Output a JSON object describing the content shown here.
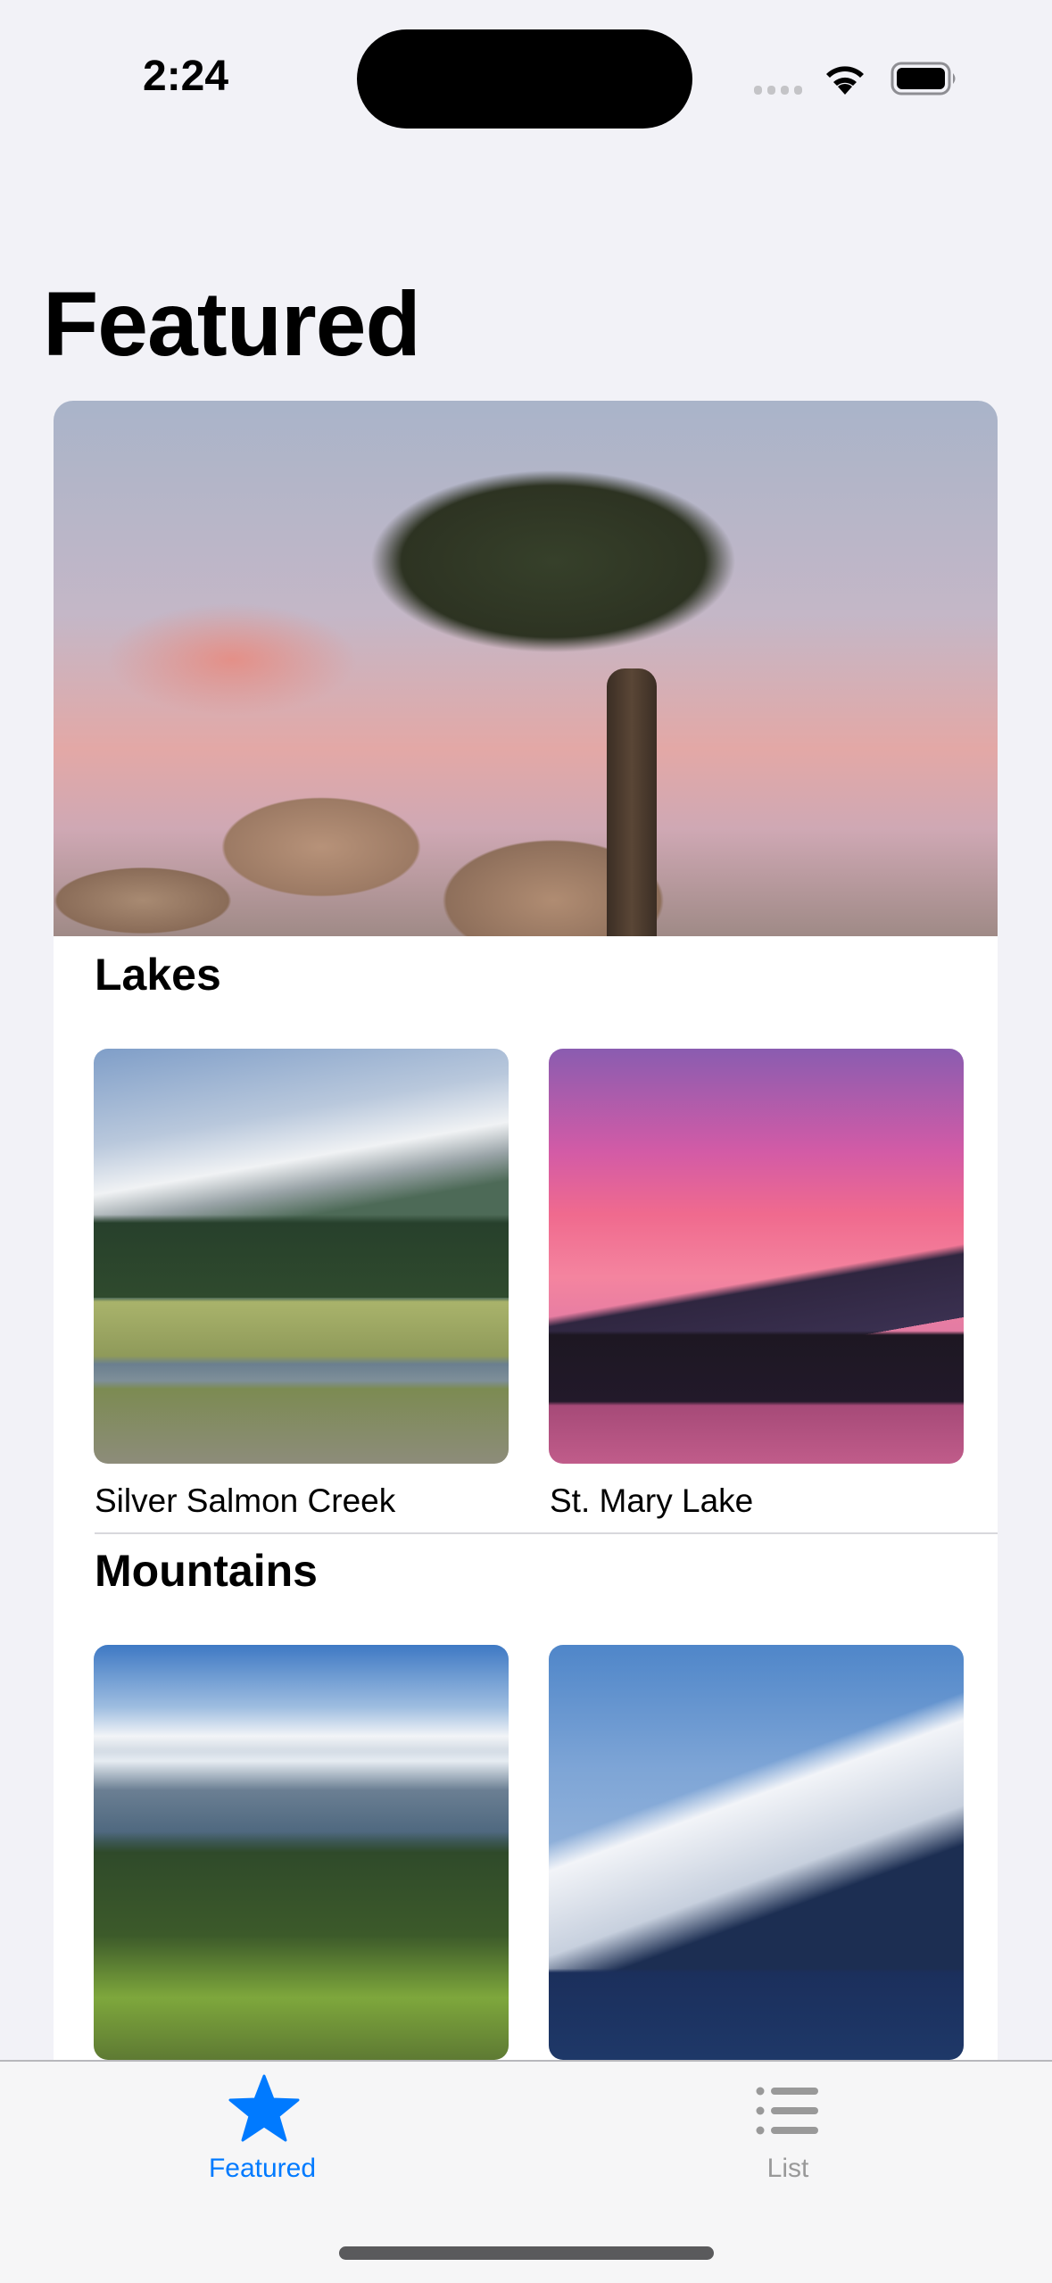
{
  "status_bar": {
    "time": "2:24",
    "icons": [
      "cellular-signal-icon",
      "wifi-icon",
      "battery-icon"
    ]
  },
  "page": {
    "title": "Featured"
  },
  "featured_image": {
    "description_icon": "joshua-tree-photo"
  },
  "sections": [
    {
      "title": "Lakes",
      "items": [
        {
          "name": "Silver Salmon Creek"
        },
        {
          "name": "St. Mary Lake"
        }
      ]
    },
    {
      "title": "Mountains",
      "items": [
        {
          "name": ""
        },
        {
          "name": ""
        }
      ]
    }
  ],
  "tab_bar": {
    "tabs": [
      {
        "label": "Featured",
        "icon": "star-icon",
        "selected": true
      },
      {
        "label": "List",
        "icon": "list-icon",
        "selected": false
      }
    ],
    "accent_color": "#007aff",
    "inactive_color": "#999999"
  }
}
